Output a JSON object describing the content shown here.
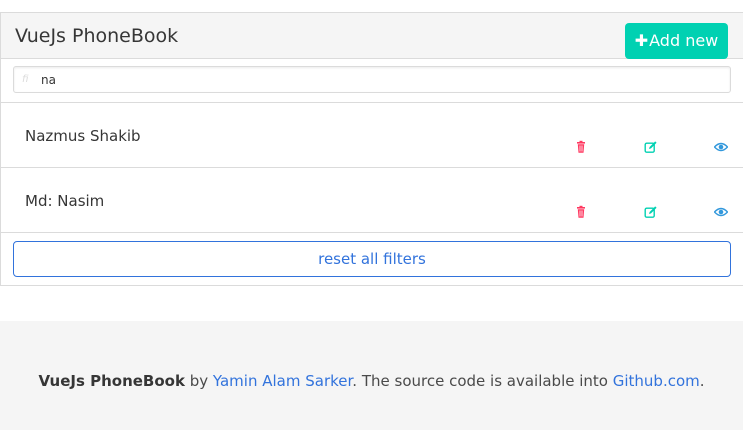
{
  "header": {
    "title": "VueJs PhoneBook",
    "add_button_label": "Add new",
    "add_button_icon": "plus-icon"
  },
  "search": {
    "value": "na",
    "icon": "search-icon"
  },
  "contacts": [
    {
      "name": "Nazmus Shakib"
    },
    {
      "name": "Md: Nasim"
    }
  ],
  "row_actions": {
    "delete_icon": "trash-icon",
    "edit_icon": "edit-icon",
    "view_icon": "eye-icon",
    "delete_color": "#ff3860",
    "edit_color": "#00d1b2",
    "view_color": "#3298dc"
  },
  "reset_label": "reset all filters",
  "footer": {
    "app_name": "VueJs PhoneBook",
    "by_text": " by ",
    "author": "Yamin Alam Sarker",
    "source_text": ". The source code is available into ",
    "repo_link": "Github.com",
    "end": "."
  },
  "colors": {
    "primary": "#00d1b2",
    "link": "#3273dc",
    "danger": "#ff3860",
    "info": "#3298dc",
    "heading_bg": "#f5f5f5"
  }
}
